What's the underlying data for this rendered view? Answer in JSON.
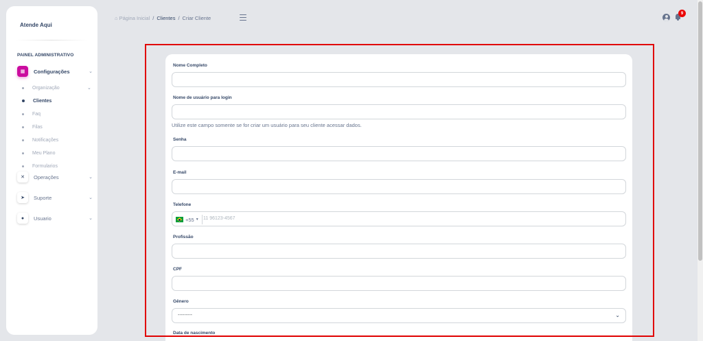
{
  "app": {
    "brand": "Atende Aqui"
  },
  "sidebar": {
    "section_title": "PAINEL ADMINISTRATIVO",
    "groups": [
      {
        "label": "Configurações",
        "icon": "building-icon",
        "active": true
      },
      {
        "label": "Operações",
        "icon": "tools-icon"
      },
      {
        "label": "Suporte",
        "icon": "rocket-icon"
      },
      {
        "label": "Usuario",
        "icon": "users-icon"
      }
    ],
    "sub_items": [
      {
        "label": "Organização",
        "has_chevron": true
      },
      {
        "label": "Clientes",
        "active": true
      },
      {
        "label": "Faq"
      },
      {
        "label": "Filas"
      },
      {
        "label": "Notificações"
      },
      {
        "label": "Meu Plano"
      },
      {
        "label": "Formularios"
      }
    ]
  },
  "breadcrumb": {
    "home": "Página Inicial",
    "link": "Clientes",
    "current": "Criar Cliente"
  },
  "header": {
    "notification_count": "9"
  },
  "form": {
    "nome_completo": {
      "label": "Nome Completo",
      "value": ""
    },
    "username": {
      "label": "Nome de usuário para login",
      "value": "",
      "help": "Utilize este campo somente se for criar um usuário para seu cliente acessar dados."
    },
    "senha": {
      "label": "Senha",
      "value": ""
    },
    "email": {
      "label": "E-mail",
      "value": ""
    },
    "telefone": {
      "label": "Telefone",
      "dial_code": "+55",
      "placeholder": "11 96123-4567"
    },
    "profissao": {
      "label": "Profissão",
      "value": ""
    },
    "cpf": {
      "label": "CPF",
      "value": ""
    },
    "genero": {
      "label": "Gênero",
      "selected": "---------"
    },
    "nascimento": {
      "label": "Data de nascimento"
    }
  },
  "colors": {
    "accent": "#cb0c9f",
    "badge": "#ea0606",
    "highlight": "#e00000",
    "text": "#344767"
  }
}
